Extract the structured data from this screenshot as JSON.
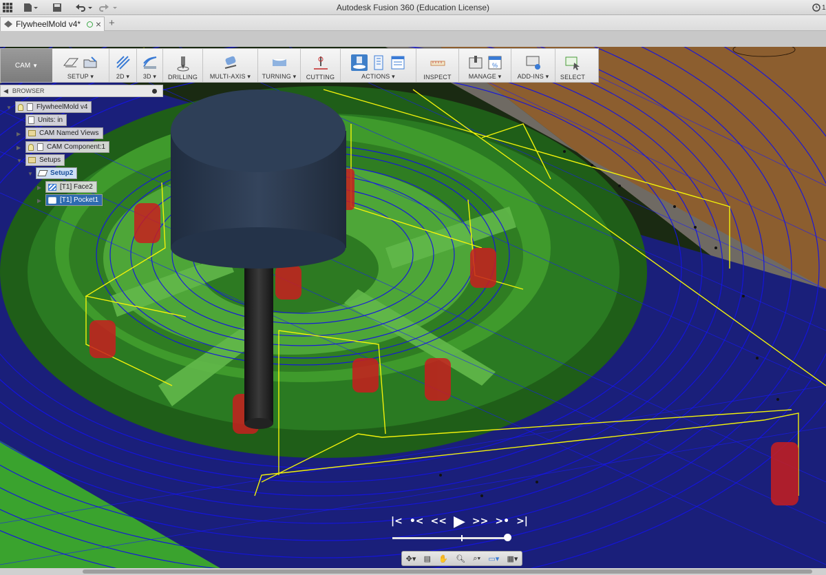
{
  "window": {
    "title": "Autodesk Fusion 360 (Education License)",
    "clock_partial": "1"
  },
  "document_tab": {
    "name": "FlywheelMold v4*",
    "status_icon": "circle-icon",
    "close": "×",
    "new_tab": "+"
  },
  "toolbar": {
    "workspace": "CAM",
    "groups": [
      {
        "label": "SETUP ▾"
      },
      {
        "label": "2D ▾"
      },
      {
        "label": "3D ▾"
      },
      {
        "label": "DRILLING"
      },
      {
        "label": "MULTI-AXIS ▾"
      },
      {
        "label": "TURNING ▾"
      },
      {
        "label": "CUTTING"
      },
      {
        "label": "ACTIONS ▾"
      },
      {
        "label": "INSPECT"
      },
      {
        "label": "MANAGE ▾"
      },
      {
        "label": "ADD-INS ▾"
      },
      {
        "label": "SELECT"
      }
    ]
  },
  "browser": {
    "header": "BROWSER",
    "tree": {
      "root": "FlywheelMold v4",
      "units": "Units: in",
      "named_views": "CAM Named Views",
      "component": "CAM Component:1",
      "setups": "Setups",
      "setup2": "Setup2",
      "op1": "[T1] Face2",
      "op2": "[T1] Pocket1"
    }
  },
  "colors": {
    "accent": "#3f7fc9",
    "toolpath": "#1010d8",
    "link_moves": "#f2f20a",
    "part": "#2e8a1c",
    "stock": "#9a6a3a"
  }
}
